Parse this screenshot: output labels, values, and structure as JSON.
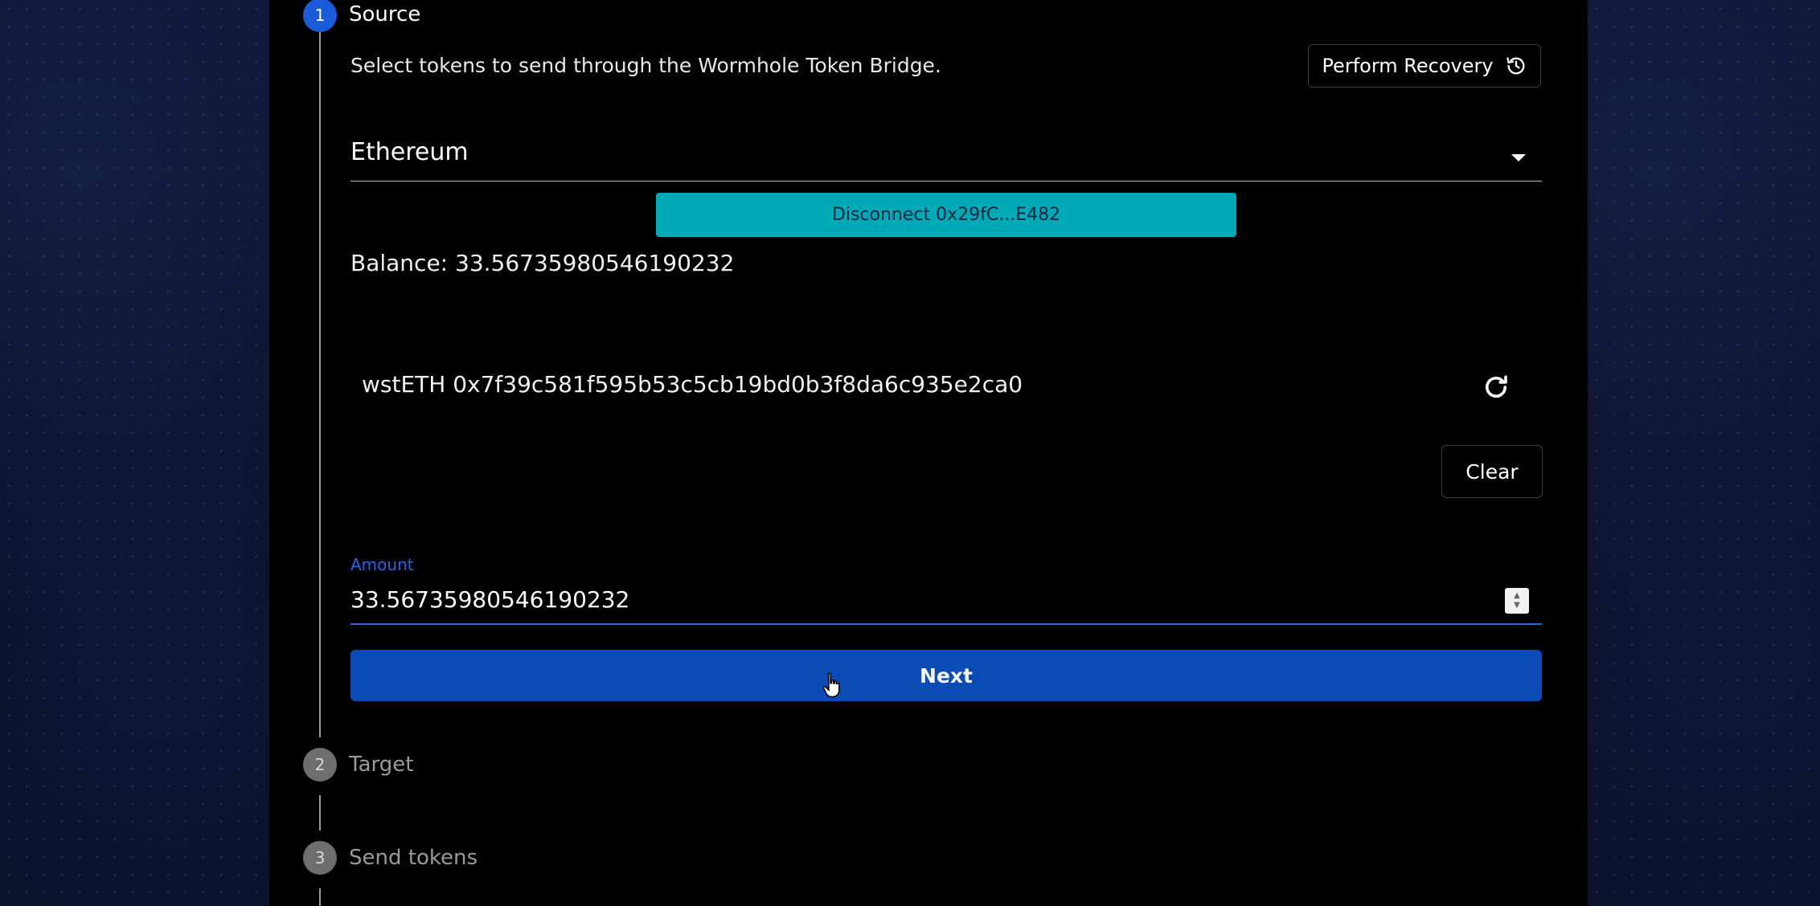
{
  "stepper": {
    "steps": [
      {
        "number": "1",
        "label": "Source"
      },
      {
        "number": "2",
        "label": "Target"
      },
      {
        "number": "3",
        "label": "Send tokens"
      }
    ]
  },
  "source": {
    "description": "Select tokens to send through the Wormhole Token Bridge.",
    "recovery_label": "Perform Recovery",
    "recovery_icon": "history-icon",
    "chain_selected": "Ethereum",
    "disconnect_label": "Disconnect 0x29fC...E482",
    "balance_text": "Balance: 33.56735980546190232",
    "token_text": "wstETH 0x7f39c581f595b53c5cb19bd0b3f8da6c935e2ca0",
    "refresh_icon": "refresh-icon",
    "clear_label": "Clear",
    "amount_label": "Amount",
    "amount_value": "33.56735980546190232",
    "next_label": "Next"
  },
  "colors": {
    "active_step": "#1a5bd9",
    "inactive_step": "#6e6e6e",
    "disconnect_bg": "#00a9b6",
    "primary_button": "#0a4bb5",
    "focus_accent": "#2b63e0"
  }
}
